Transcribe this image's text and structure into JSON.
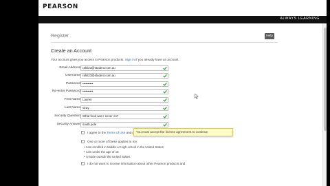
{
  "header": {
    "logo": "PEARSON",
    "tagline": "ALWAYS LEARNING"
  },
  "page": {
    "title": "Register",
    "help_label": "Help"
  },
  "form": {
    "section_title": "Create an Account",
    "intro_prefix": "Your account gives you access to Pearson products.",
    "intro_link": "Sign in",
    "intro_suffix": "if you already have an account.",
    "fields": [
      {
        "label": "Email Address",
        "value": "rahil23@student.com.au"
      },
      {
        "label": "Username",
        "value": "rahil23@student.com.au"
      },
      {
        "label": "Password",
        "value": "••••••••••"
      },
      {
        "label": "Re-enter Password",
        "value": "••••••••••"
      },
      {
        "label": "First Name",
        "value": "Lauren"
      },
      {
        "label": "Last Name",
        "value": "Gray"
      },
      {
        "label": "Security Question",
        "value": "What food was I never on?"
      },
      {
        "label": "Security Answer",
        "value": "south pole"
      }
    ],
    "agree_prefix": "I agree to the",
    "agree_link": "Terms of Use",
    "agree_suffix": "and",
    "tooltip": "You must accept the license agreement to continue.",
    "applies_title": "One or more of these applies to me:",
    "applies_items": [
      "I am enrolled in Middle or High school in the United States",
      "I am under the age of 18",
      "I reside outside the United States"
    ],
    "receive_text": "I do not want to receive information about other Pearson products and"
  },
  "colors": {
    "header_band": "#111111",
    "link": "#2a6ebb",
    "check": "#3a9a3a",
    "tooltip_bg": "#fffcc8"
  }
}
